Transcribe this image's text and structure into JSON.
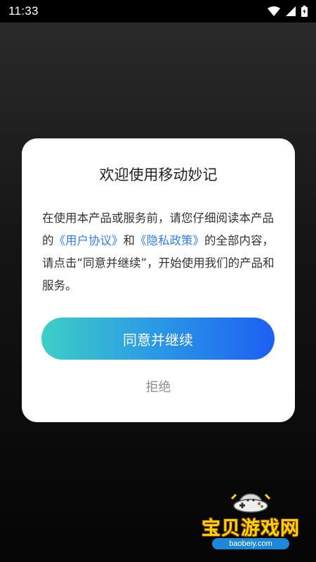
{
  "status_bar": {
    "time": "11:33",
    "icons": [
      "wifi-icon",
      "signal-icon",
      "battery-icon"
    ]
  },
  "dialog": {
    "title": "欢迎使用移动妙记",
    "body": {
      "part1": "在使用本产品或服务前，请您仔细阅读本产品的",
      "link_user_agreement": "《用户协议》",
      "part2": "和",
      "link_privacy_policy": "《隐私政策》",
      "part3": "的全部内容，请点击“同意并继续”，开始使用我们的产品和服务。"
    },
    "agree_label": "同意并继续",
    "reject_label": "拒绝"
  },
  "watermark": {
    "text": "宝贝游戏网",
    "url": "baobeiy.com"
  },
  "colors": {
    "link": "#2f7ef5",
    "button_gradient_start": "#3dcfc6",
    "button_gradient_end": "#1d5ff3",
    "reject_text": "#8c8c8c"
  }
}
